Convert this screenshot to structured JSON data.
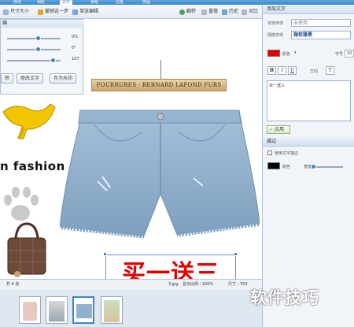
{
  "topbar": {
    "tabs": [
      "修改",
      "相机",
      "文字",
      "相框",
      "边框",
      "拼图"
    ]
  },
  "toolbar": {
    "resize_label": "尺寸大小",
    "undo_step_label": "撤销这一步",
    "single_edit_label": "单张编辑",
    "rotate_label": "翻转",
    "redo_label": "重做",
    "history_label": "历史",
    "compare_label": "对比"
  },
  "left_panel": {
    "title": "编",
    "sliders": [
      {
        "value_text": "0%",
        "level": 0.55
      },
      {
        "value_text": "0°",
        "level": 0.55
      },
      {
        "value_text": "107",
        "level": 0.82
      }
    ],
    "buttons": {
      "delete_label": "除",
      "edit_text_label": "修改文字",
      "save_watermark_label": "存为水印"
    }
  },
  "canvas": {
    "brand_tag": "FOURRURES · BERNARD LAFOND FURS",
    "fashion_text": "n fashion",
    "promo_text": "买一送三",
    "accent_red": "#e00000",
    "denim_color": "#8fb1cf"
  },
  "right_panel": {
    "header": "添加文字",
    "local_font_label": "本地字体",
    "local_font_value": "未使用",
    "web_font_label": "网络字体",
    "web_font_value": "微软雅黑",
    "color_label": "颜色",
    "color_value": "#e00000",
    "size_label": "字号",
    "size_value": "10",
    "bold_label": "B",
    "italic_label": "I",
    "underline_label": "U",
    "direction_label": "方向",
    "text_value": "买一送三",
    "apply_label": "应用",
    "shadow_header": "描边",
    "shadow_checkbox_label": "使用文字描边",
    "stroke_color_label": "颜色",
    "width_label": "宽度"
  },
  "statusbar": {
    "count_text": "共 4 张",
    "filename": "3.jpg",
    "zoom_text": "显示比例 : 100%",
    "size_text": "尺寸 : 750"
  },
  "watermark": "软件技巧"
}
